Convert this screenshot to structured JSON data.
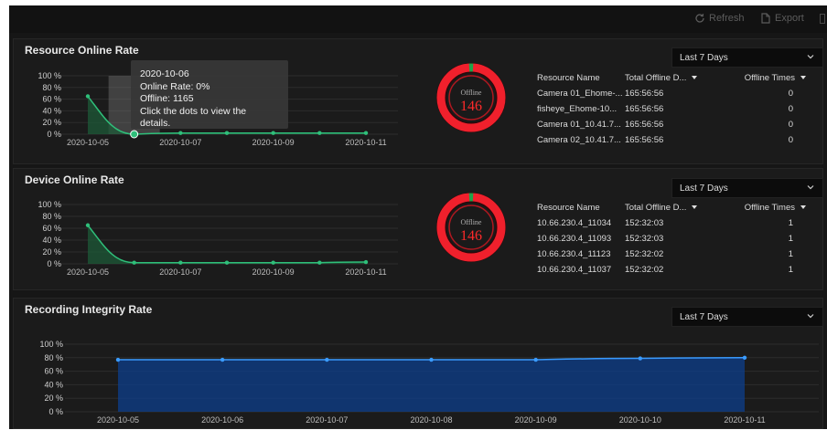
{
  "toolbar": {
    "refresh_label": "Refresh",
    "export_label": "Export",
    "refresh_icon": "refresh-icon",
    "export_icon": "export-icon"
  },
  "resource_online": {
    "title": "Resource Online Rate",
    "period": "Last 7 Days",
    "donut": {
      "label": "Offline",
      "value": "146",
      "offline_fraction": 0.98
    },
    "table": {
      "headers": [
        "Resource Name",
        "Total Offline D...",
        "Offline Times"
      ],
      "rows": [
        [
          "Camera 01_Ehome-...",
          "165:56:56",
          "0"
        ],
        [
          "fisheye_Ehome-10...",
          "165:56:56",
          "0"
        ],
        [
          "Camera 01_10.41.7...",
          "165:56:56",
          "0"
        ],
        [
          "Camera 02_10.41.7...",
          "165:56:56",
          "0"
        ]
      ]
    },
    "tooltip": {
      "date": "2020-10-06",
      "rate": "Online Rate: 0%",
      "offline": "Offline: 1165",
      "hint": "Click the dots to view the details."
    }
  },
  "device_online": {
    "title": "Device Online Rate",
    "period": "Last 7 Days",
    "donut": {
      "label": "Offline",
      "value": "146",
      "offline_fraction": 0.98
    },
    "table": {
      "headers": [
        "Resource Name",
        "Total Offline D...",
        "Offline Times"
      ],
      "rows": [
        [
          "10.66.230.4_11034",
          "152:32:03",
          "1"
        ],
        [
          "10.66.230.4_11093",
          "152:32:03",
          "1"
        ],
        [
          "10.66.230.4_11123",
          "152:32:02",
          "1"
        ],
        [
          "10.66.230.4_11037",
          "152:32:02",
          "1"
        ]
      ]
    }
  },
  "recording_integrity": {
    "title": "Recording Integrity Rate",
    "period": "Last 7 Days"
  },
  "colors": {
    "accent_green": "#2fbf7a",
    "accent_blue": "#3a9bff",
    "donut_red": "#f0202c",
    "donut_green": "#1fa34a"
  },
  "chart_data": [
    {
      "type": "area",
      "panel": "resource_online",
      "categories": [
        "2020-10-05",
        "2020-10-06",
        "2020-10-07",
        "2020-10-08",
        "2020-10-09",
        "2020-10-10",
        "2020-10-11"
      ],
      "xtick_labels": [
        "2020-10-05",
        "2020-10-07",
        "2020-10-09",
        "2020-10-11"
      ],
      "values": [
        65,
        0,
        2,
        2,
        2,
        2,
        2
      ],
      "yticks": [
        "0 %",
        "20 %",
        "40 %",
        "60 %",
        "80 %",
        "100 %"
      ],
      "ylim": [
        0,
        100
      ],
      "xlabel": "",
      "ylabel": ""
    },
    {
      "type": "area",
      "panel": "device_online",
      "categories": [
        "2020-10-05",
        "2020-10-06",
        "2020-10-07",
        "2020-10-08",
        "2020-10-09",
        "2020-10-10",
        "2020-10-11"
      ],
      "xtick_labels": [
        "2020-10-05",
        "2020-10-07",
        "2020-10-09",
        "2020-10-11"
      ],
      "values": [
        65,
        2,
        2,
        2,
        2,
        2,
        3
      ],
      "yticks": [
        "0 %",
        "20 %",
        "40 %",
        "60 %",
        "80 %",
        "100 %"
      ],
      "ylim": [
        0,
        100
      ],
      "xlabel": "",
      "ylabel": ""
    },
    {
      "type": "area",
      "panel": "recording_integrity",
      "categories": [
        "2020-10-05",
        "2020-10-06",
        "2020-10-07",
        "2020-10-08",
        "2020-10-09",
        "2020-10-10",
        "2020-10-11"
      ],
      "xtick_labels": [
        "2020-10-05",
        "2020-10-06",
        "2020-10-07",
        "2020-10-08",
        "2020-10-09",
        "2020-10-10",
        "2020-10-11"
      ],
      "values": [
        77,
        77,
        77,
        77,
        77,
        79,
        80
      ],
      "yticks": [
        "0 %",
        "20 %",
        "40 %",
        "60 %",
        "80 %",
        "100 %"
      ],
      "ylim": [
        0,
        100
      ],
      "xlabel": "",
      "ylabel": ""
    }
  ]
}
